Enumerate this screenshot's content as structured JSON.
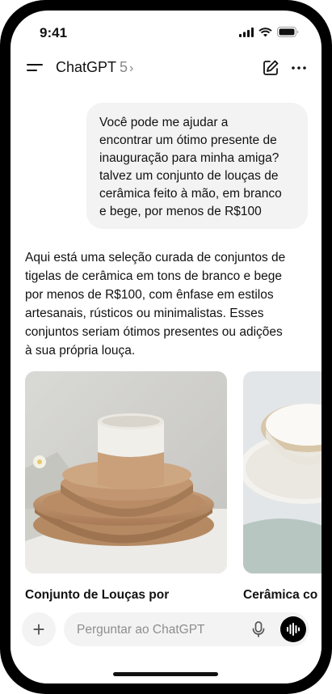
{
  "status_bar": {
    "time": "9:41"
  },
  "header": {
    "app_name": "ChatGPT",
    "model_version": "5",
    "chevron": "›"
  },
  "messages": {
    "user": "Você pode me ajudar a\nencontrar um ótimo presente de\ninauguração para minha amiga?\ntalvez um conjunto de louças de\ncerâmica feito à mão, em branco\ne bege, por menos de R$100",
    "assistant": "Aqui está uma seleção curada de conjuntos de\ntigelas de cerâmica em tons de branco e bege\npor menos de R$100, com ênfase em estilos\nartesanais, rústicos ou minimalistas. Esses\nconjuntos seriam ótimos presentes ou adições\nà sua própria louça."
  },
  "products": [
    {
      "title": "Conjunto de Louças por"
    },
    {
      "title": "Cerâmica co"
    }
  ],
  "composer": {
    "placeholder": "Perguntar ao ChatGPT",
    "plus_label": "+"
  },
  "icons": [
    "menu-icon",
    "compose-icon",
    "more-icon",
    "mic-icon",
    "voice-mode-icon",
    "signal-icon",
    "wifi-icon",
    "battery-icon"
  ]
}
